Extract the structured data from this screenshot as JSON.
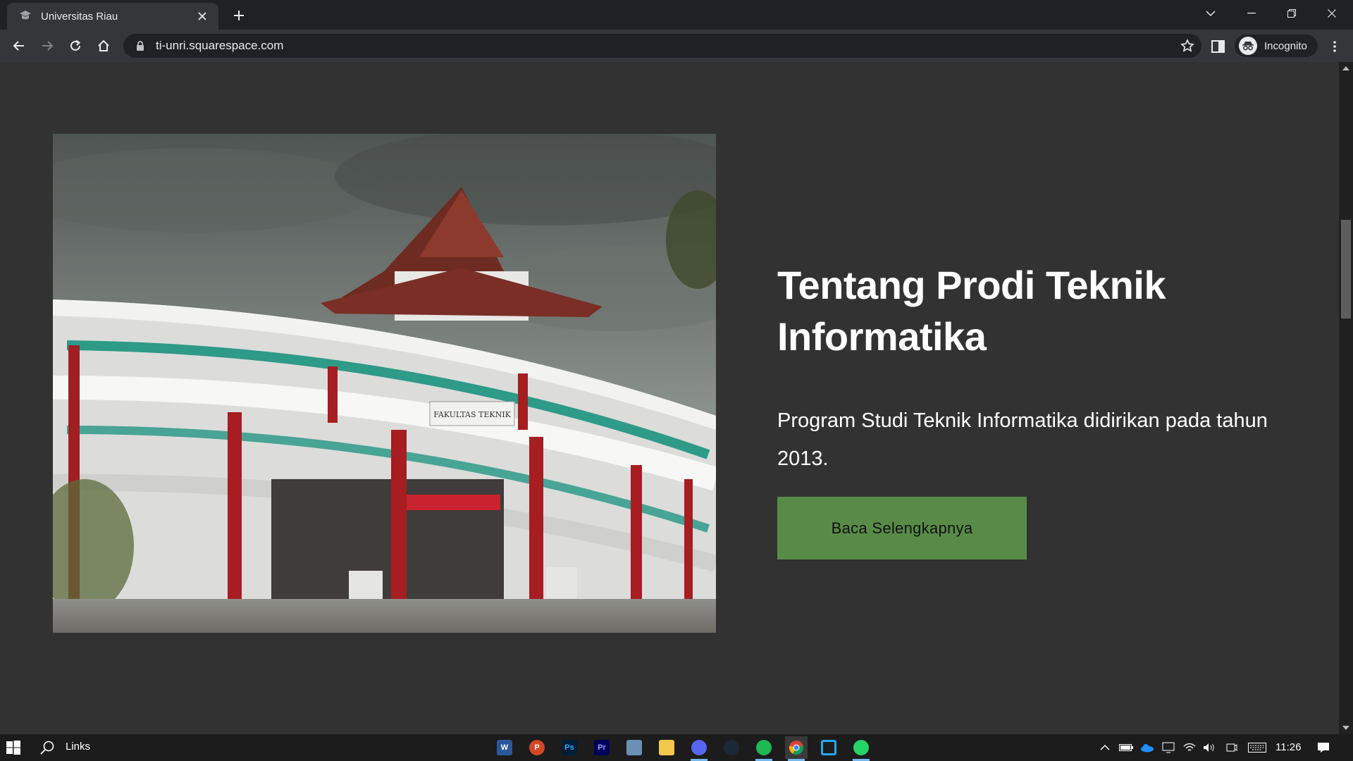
{
  "browser": {
    "tab": {
      "title": "Universitas Riau",
      "favicon": "graduation-cap-icon"
    },
    "address": "ti-unri.squarespace.com",
    "profile_label": "Incognito"
  },
  "page": {
    "image_alt": "Gedung Fakultas Teknik",
    "sign_text": "FAKULTAS TEKNIK",
    "heading": "Tentang Prodi Teknik Informatika",
    "description": "Program Studi Teknik Informatika didirikan pada tahun 2013.",
    "cta_label": "Baca Selengkapnya"
  },
  "taskbar": {
    "search_label": "Links",
    "apps": [
      "word-icon",
      "powerpoint-icon",
      "photoshop-icon",
      "premiere-icon",
      "photos-icon",
      "file-explorer-icon",
      "discord-icon",
      "steam-icon",
      "spotify-icon",
      "chrome-icon",
      "vscode-icon",
      "whatsapp-icon"
    ],
    "time": "11:26"
  },
  "colors": {
    "page_bg": "#323232",
    "cta_bg": "#588b48",
    "chrome_bg": "#35363a"
  }
}
